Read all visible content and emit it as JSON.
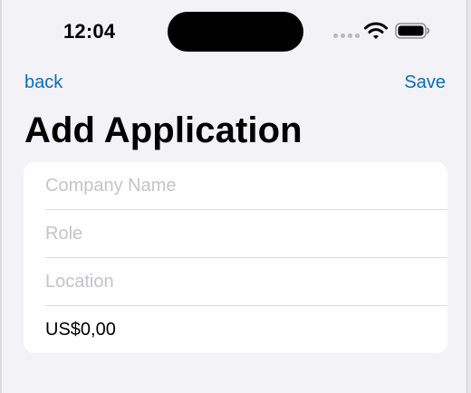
{
  "status_bar": {
    "time": "12:04",
    "icons": [
      "cellular-dots-icon",
      "wifi-icon",
      "battery-icon"
    ]
  },
  "nav": {
    "back_label": "back",
    "save_label": "Save",
    "accent_color": "#0a6ebd"
  },
  "page": {
    "title": "Add Application"
  },
  "form": {
    "company_name": {
      "placeholder": "Company Name",
      "value": ""
    },
    "role": {
      "placeholder": "Role",
      "value": ""
    },
    "location": {
      "placeholder": "Location",
      "value": ""
    },
    "salary": {
      "placeholder": "",
      "value": "US$0,00"
    }
  }
}
